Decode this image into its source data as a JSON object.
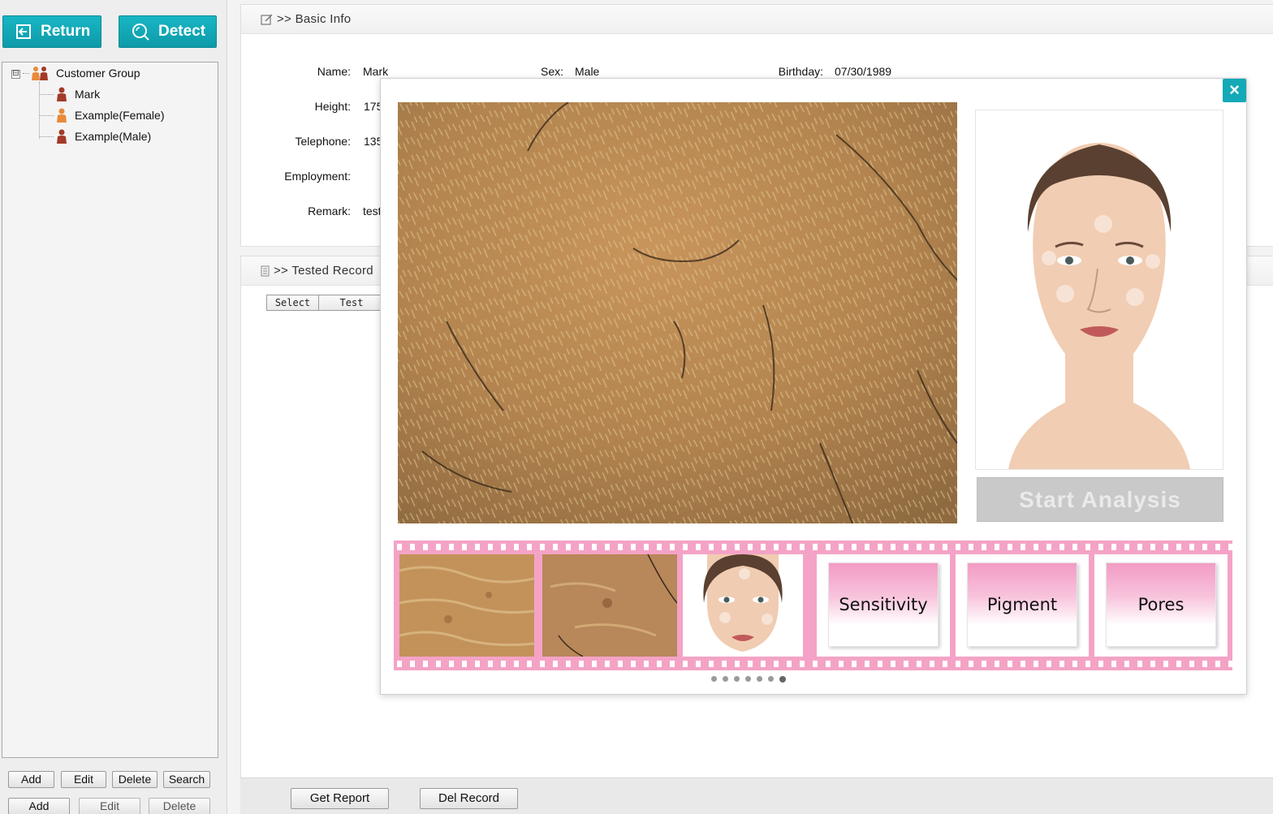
{
  "toolbar": {
    "return_label": "Return",
    "detect_label": "Detect"
  },
  "tree": {
    "group_label": "Customer Group",
    "expand_symbol": "⊟",
    "items": [
      {
        "label": "Mark"
      },
      {
        "label": "Example(Female)"
      },
      {
        "label": "Example(Male)"
      }
    ]
  },
  "customer_buttons": {
    "add": "Add",
    "edit": "Edit",
    "delete": "Delete",
    "search": "Search"
  },
  "record_buttons": {
    "add": "Add",
    "edit": "Edit",
    "delete": "Delete"
  },
  "basic_info": {
    "title": ">> Basic Info",
    "name_label": "Name:",
    "name_value": "Mark",
    "sex_label": "Sex:",
    "sex_value": "Male",
    "birthday_label": "Birthday:",
    "birthday_value": "07/30/1989",
    "height_label": "Height:",
    "height_value": "175",
    "telephone_label": "Telephone:",
    "telephone_value": "135",
    "employment_label": "Employment:",
    "remark_label": "Remark:",
    "remark_value": "test"
  },
  "tested_record": {
    "title": ">> Tested Record",
    "columns": [
      "Select",
      "Test"
    ]
  },
  "bottom_buttons": {
    "get_report": "Get Report",
    "del_record": "Del Record"
  },
  "modal": {
    "close_symbol": "×",
    "start_analysis": "Start Analysis",
    "thumbnails": [
      "Sensitivity",
      "Pigment",
      "Pores"
    ],
    "page_count": 7,
    "active_page": 7
  },
  "colors": {
    "accent": "#14a9b7",
    "film": "#f4a3c6",
    "skin": "#b98a55"
  }
}
